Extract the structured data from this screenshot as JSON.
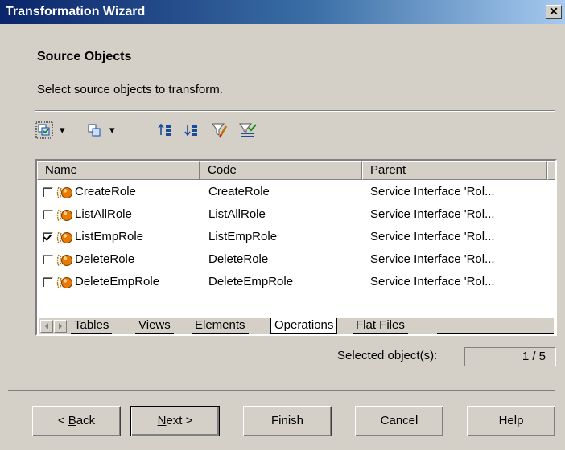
{
  "window": {
    "title": "Transformation Wizard",
    "close_label": "✕"
  },
  "page": {
    "heading": "Source Objects",
    "subtitle": "Select source objects to transform."
  },
  "toolbar": {
    "dropdown_arrow": "▾"
  },
  "table": {
    "columns": [
      "Name",
      "Code",
      "Parent"
    ],
    "rows": [
      {
        "checked": false,
        "name": "CreateRole",
        "code": "CreateRole",
        "parent": "Service Interface 'Rol..."
      },
      {
        "checked": false,
        "name": "ListAllRole",
        "code": "ListAllRole",
        "parent": "Service Interface 'Rol..."
      },
      {
        "checked": true,
        "name": "ListEmpRole",
        "code": "ListEmpRole",
        "parent": "Service Interface 'Rol..."
      },
      {
        "checked": false,
        "name": "DeleteRole",
        "code": "DeleteRole",
        "parent": "Service Interface 'Rol..."
      },
      {
        "checked": false,
        "name": "DeleteEmpRole",
        "code": "DeleteEmpRole",
        "parent": "Service Interface 'Rol..."
      }
    ]
  },
  "tabs": [
    "Tables",
    "Views",
    "Elements",
    "Operations",
    "Flat Files"
  ],
  "active_tab": "Operations",
  "selection": {
    "label": "Selected object(s):",
    "value": "1 / 5"
  },
  "buttons": {
    "back": {
      "prefix": "< ",
      "accel": "B",
      "rest": "ack"
    },
    "next": {
      "accel": "N",
      "rest": "ext >"
    },
    "finish": "Finish",
    "cancel": "Cancel",
    "help": "Help"
  },
  "colors": {
    "title_start": "#0a246a",
    "title_end": "#a6caf0",
    "face": "#d4d0c8"
  }
}
